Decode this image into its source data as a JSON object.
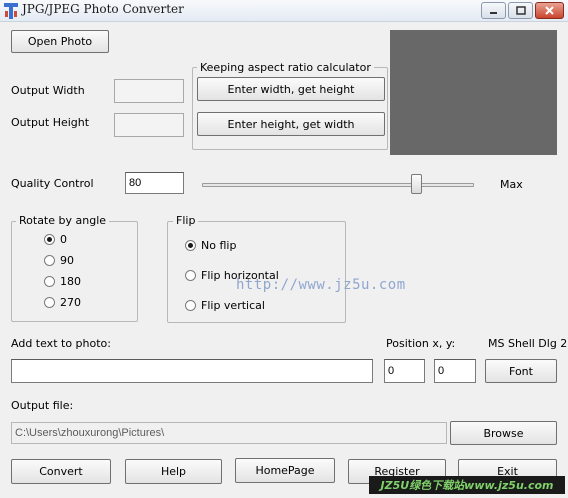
{
  "window": {
    "title": "JPG/JPEG Photo Converter",
    "icon": "app-icon",
    "controls": [
      "minimize-icon",
      "maximize-icon",
      "close-icon"
    ]
  },
  "buttons": {
    "open_photo": "Open Photo",
    "width_to_height": "Enter width, get height",
    "height_to_width": "Enter height, get width",
    "font": "Font",
    "browse": "Browse",
    "convert": "Convert",
    "help": "Help",
    "homepage": "HomePage",
    "register": "Register",
    "exit": "Exit"
  },
  "output_size": {
    "width_label": "Output Width",
    "height_label": "Output Height",
    "width_value": "",
    "height_value": ""
  },
  "aspect_group": {
    "legend": "Keeping aspect ratio calculator"
  },
  "quality": {
    "label": "Quality Control",
    "value": "80",
    "slider_position": 0.8,
    "max_label": "Max"
  },
  "rotate": {
    "legend": "Rotate by angle",
    "options": [
      "0",
      "90",
      "180",
      "270"
    ],
    "selected": "0"
  },
  "flip": {
    "legend": "Flip",
    "options": [
      "No flip",
      "Flip horizontal",
      "Flip vertical"
    ],
    "selected": "No flip"
  },
  "text_overlay": {
    "label": "Add text to photo:",
    "value": "",
    "position_label": "Position x, y:",
    "x": "0",
    "y": "0",
    "font_name": "MS Shell Dlg 2"
  },
  "output_file": {
    "label": "Output file:",
    "path": "C:\\Users\\zhouxurong\\Pictures\\"
  },
  "watermark": {
    "url": "http://www.jz5u.com",
    "banner": "JZ5U绿色下载站www.jz5u.com"
  },
  "colors": {
    "preview": "#686868",
    "window_bg": "#f0f0f0"
  }
}
